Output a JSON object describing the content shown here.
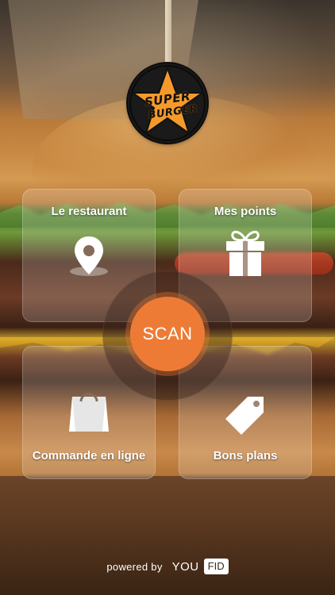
{
  "brand": {
    "logo_line1": "SUPER",
    "logo_line2": "BURGER",
    "logo_color": "#f59a2a"
  },
  "tiles": [
    {
      "label": "Le restaurant",
      "icon": "map-pin-icon"
    },
    {
      "label": "Mes points",
      "icon": "gift-icon"
    },
    {
      "label": "Commande en ligne",
      "icon": "shopping-bag-icon"
    },
    {
      "label": "Bons plans",
      "icon": "tag-icon"
    }
  ],
  "scan": {
    "label": "SCAN",
    "color": "#ee7b35"
  },
  "footer": {
    "powered": "powered by",
    "you": "YOU",
    "fid": "FID"
  }
}
